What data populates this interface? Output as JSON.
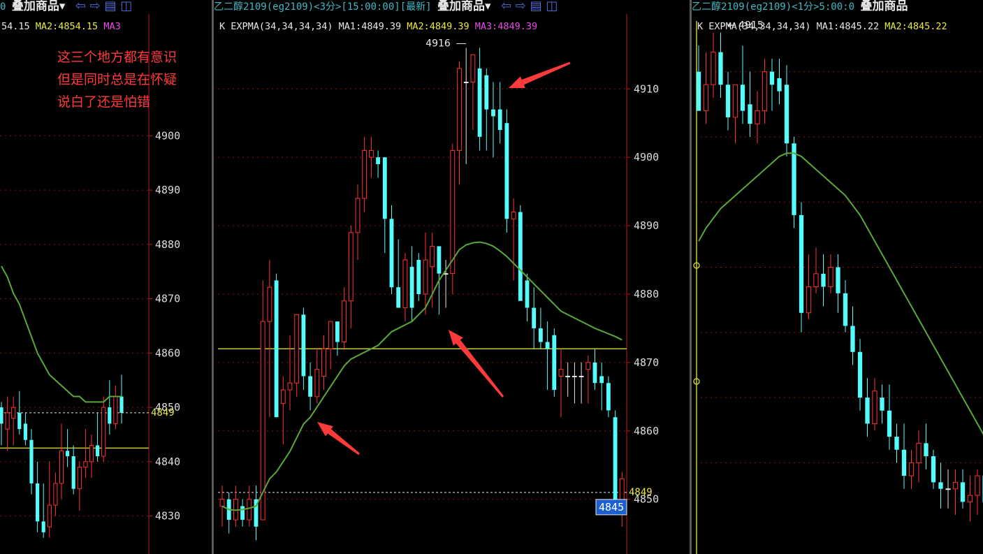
{
  "annotation": {
    "line1": "这三个地方都有意识",
    "line2": "但是同时总是在怀疑",
    "line3": "说白了还是怕错"
  },
  "colors": {
    "up": "#ff3232",
    "down": "#54fcfc",
    "ma": "#5aa83a",
    "hline": "#c8c83a",
    "grid": "#8a1010",
    "axis": "#c01818",
    "annotation": "#ff3a3a",
    "price_box": "#1c5fd0"
  },
  "panes": [
    {
      "header": {
        "pre": "0",
        "bold": "叠加商品▾",
        "icons": "⇦ ⇨ ▤ ◫"
      },
      "indicator": {
        "text1": "54.15",
        "ma2": "MA2:4854.15",
        "ma3": "MA3"
      },
      "chart_data": {
        "type": "candlestick",
        "ylim": [
          4823,
          4925
        ],
        "y_ticks": [
          4830,
          4840,
          4850,
          4860,
          4870,
          4880,
          4890,
          4900
        ],
        "hline": 4842.5,
        "last_price": 4849,
        "last_label": "4849",
        "candles": [
          {
            "o": 4850,
            "h": 4851,
            "l": 4843,
            "c": 4847
          },
          {
            "o": 4846,
            "h": 4852,
            "l": 4842,
            "c": 4849
          },
          {
            "o": 4848,
            "h": 4852,
            "l": 4843,
            "c": 4850
          },
          {
            "o": 4849,
            "h": 4853,
            "l": 4845,
            "c": 4846
          },
          {
            "o": 4847,
            "h": 4849,
            "l": 4843,
            "c": 4844
          },
          {
            "o": 4844,
            "h": 4846,
            "l": 4834,
            "c": 4836
          },
          {
            "o": 4836,
            "h": 4840,
            "l": 4827,
            "c": 4829
          },
          {
            "o": 4829,
            "h": 4836,
            "l": 4826,
            "c": 4827
          },
          {
            "o": 4828,
            "h": 4840,
            "l": 4826,
            "c": 4832
          },
          {
            "o": 4832,
            "h": 4838,
            "l": 4830,
            "c": 4836
          },
          {
            "o": 4836,
            "h": 4847,
            "l": 4833,
            "c": 4842
          },
          {
            "o": 4842,
            "h": 4846,
            "l": 4839,
            "c": 4841
          },
          {
            "o": 4841,
            "h": 4843,
            "l": 4834,
            "c": 4835
          },
          {
            "o": 4835,
            "h": 4840,
            "l": 4831,
            "c": 4839
          },
          {
            "o": 4839,
            "h": 4846,
            "l": 4837,
            "c": 4840
          },
          {
            "o": 4840,
            "h": 4845,
            "l": 4837,
            "c": 4843
          },
          {
            "o": 4843,
            "h": 4849,
            "l": 4840,
            "c": 4841
          },
          {
            "o": 4841,
            "h": 4852,
            "l": 4840,
            "c": 4850
          },
          {
            "o": 4850,
            "h": 4855,
            "l": 4845,
            "c": 4847
          },
          {
            "o": 4847,
            "h": 4854,
            "l": 4846,
            "c": 4852
          },
          {
            "o": 4852,
            "h": 4856,
            "l": 4847,
            "c": 4849
          }
        ],
        "ma": [
          4876,
          4874,
          4871,
          4869,
          4866,
          4863,
          4860,
          4858,
          4856,
          4855,
          4854,
          4853,
          4852,
          4852,
          4851,
          4851,
          4851,
          4851,
          4852,
          4852,
          4852
        ]
      }
    },
    {
      "header": {
        "pre": "乙二醇2109(eg2109)<3分>[15:00:00][最新]",
        "bold": "叠加商品▾",
        "icons": "⇦ ⇨ ▤ ◫"
      },
      "indicator": {
        "text1": "K EXPMA(34,34,34,34) MA1:4849.39",
        "ma2": "MA2:4849.39",
        "ma3": "MA3:4849.39"
      },
      "chart_data": {
        "type": "candlestick",
        "ylim": [
          4842,
          4923
        ],
        "y_ticks": [
          4850,
          4860,
          4870,
          4880,
          4890,
          4900,
          4910
        ],
        "hline": 4872,
        "last_price": 4851,
        "last_label": "4849",
        "price_box": "4845",
        "max_label": "4916",
        "candles": [
          {
            "o": 4849,
            "h": 4852,
            "l": 4846,
            "c": 4850
          },
          {
            "o": 4850,
            "h": 4851,
            "l": 4845,
            "c": 4847
          },
          {
            "o": 4847,
            "h": 4852,
            "l": 4846,
            "c": 4850
          },
          {
            "o": 4849,
            "h": 4850,
            "l": 4846,
            "c": 4847
          },
          {
            "o": 4847,
            "h": 4852,
            "l": 4846,
            "c": 4850
          },
          {
            "o": 4850,
            "h": 4852,
            "l": 4844,
            "c": 4846
          },
          {
            "o": 4847,
            "h": 4882,
            "l": 4847,
            "c": 4876
          },
          {
            "o": 4876,
            "h": 4885,
            "l": 4862,
            "c": 4881
          },
          {
            "o": 4882,
            "h": 4883,
            "l": 4862,
            "c": 4862
          },
          {
            "o": 4864,
            "h": 4868,
            "l": 4858,
            "c": 4866
          },
          {
            "o": 4866,
            "h": 4874,
            "l": 4863,
            "c": 4867
          },
          {
            "o": 4867,
            "h": 4877,
            "l": 4865,
            "c": 4877
          },
          {
            "o": 4877,
            "h": 4878,
            "l": 4866,
            "c": 4868
          },
          {
            "o": 4868,
            "h": 4870,
            "l": 4863,
            "c": 4865
          },
          {
            "o": 4865,
            "h": 4872,
            "l": 4864,
            "c": 4869
          },
          {
            "o": 4868,
            "h": 4874,
            "l": 4866,
            "c": 4872
          },
          {
            "o": 4872,
            "h": 4875,
            "l": 4869,
            "c": 4876
          },
          {
            "o": 4876,
            "h": 4876,
            "l": 4871,
            "c": 4873
          },
          {
            "o": 4873,
            "h": 4881,
            "l": 4872,
            "c": 4879
          },
          {
            "o": 4879,
            "h": 4890,
            "l": 4875,
            "c": 4889
          },
          {
            "o": 4889,
            "h": 4896,
            "l": 4885,
            "c": 4894
          },
          {
            "o": 4894,
            "h": 4903,
            "l": 4892,
            "c": 4901
          },
          {
            "o": 4900,
            "h": 4903,
            "l": 4897,
            "c": 4901
          },
          {
            "o": 4900,
            "h": 4901,
            "l": 4897,
            "c": 4899
          },
          {
            "o": 4900,
            "h": 4900,
            "l": 4886,
            "c": 4891
          },
          {
            "o": 4891,
            "h": 4893,
            "l": 4880,
            "c": 4881
          },
          {
            "o": 4881,
            "h": 4888,
            "l": 4879,
            "c": 4878
          },
          {
            "o": 4878,
            "h": 4886,
            "l": 4876,
            "c": 4885
          },
          {
            "o": 4884,
            "h": 4887,
            "l": 4876,
            "c": 4878
          },
          {
            "o": 4885,
            "h": 4886,
            "l": 4879,
            "c": 4880
          },
          {
            "o": 4880,
            "h": 4889,
            "l": 4877,
            "c": 4885
          },
          {
            "o": 4884,
            "h": 4889,
            "l": 4878,
            "c": 4887
          },
          {
            "o": 4887,
            "h": 4887,
            "l": 4877,
            "c": 4883
          },
          {
            "o": 4883,
            "h": 4885,
            "l": 4878,
            "c": 4883
          },
          {
            "o": 4883,
            "h": 4902,
            "l": 4880,
            "c": 4901
          },
          {
            "o": 4901,
            "h": 4914,
            "l": 4896,
            "c": 4913
          },
          {
            "o": 4911,
            "h": 4916,
            "l": 4899,
            "c": 4911
          },
          {
            "o": 4911,
            "h": 4913,
            "l": 4904,
            "c": 4915
          },
          {
            "o": 4913,
            "h": 4916,
            "l": 4901,
            "c": 4903
          },
          {
            "o": 4912,
            "h": 4913,
            "l": 4901,
            "c": 4907
          },
          {
            "o": 4907,
            "h": 4911,
            "l": 4900,
            "c": 4906
          },
          {
            "o": 4907,
            "h": 4911,
            "l": 4902,
            "c": 4904
          },
          {
            "o": 4905,
            "h": 4907,
            "l": 4889,
            "c": 4891
          },
          {
            "o": 4891,
            "h": 4894,
            "l": 4882,
            "c": 4892
          },
          {
            "o": 4892,
            "h": 4893,
            "l": 4880,
            "c": 4879
          },
          {
            "o": 4882,
            "h": 4883,
            "l": 4876,
            "c": 4878
          },
          {
            "o": 4878,
            "h": 4881,
            "l": 4872,
            "c": 4875
          },
          {
            "o": 4875,
            "h": 4878,
            "l": 4872,
            "c": 4873
          },
          {
            "o": 4873,
            "h": 4876,
            "l": 4866,
            "c": 4872
          },
          {
            "o": 4874,
            "h": 4875,
            "l": 4865,
            "c": 4866
          },
          {
            "o": 4868,
            "h": 4872,
            "l": 4862,
            "c": 4869
          },
          {
            "o": 4868,
            "h": 4870,
            "l": 4865,
            "c": 4868
          },
          {
            "o": 4868,
            "h": 4870,
            "l": 4864,
            "c": 4868
          },
          {
            "o": 4868,
            "h": 4870,
            "l": 4864,
            "c": 4868
          },
          {
            "o": 4869,
            "h": 4871,
            "l": 4864,
            "c": 4870
          },
          {
            "o": 4870,
            "h": 4872,
            "l": 4866,
            "c": 4867
          },
          {
            "o": 4868,
            "h": 4870,
            "l": 4863,
            "c": 4867
          },
          {
            "o": 4867,
            "h": 4868,
            "l": 4862,
            "c": 4863
          },
          {
            "o": 4862,
            "h": 4863,
            "l": 4848,
            "c": 4848
          },
          {
            "o": 4848,
            "h": 4854,
            "l": 4846,
            "c": 4853
          }
        ],
        "ma": [
          4849,
          4848.5,
          4848.4,
          4848.5,
          4848.7,
          4849,
          4851,
          4853,
          4854,
          4855.5,
          4857,
          4859,
          4861,
          4862,
          4863.5,
          4865,
          4866.5,
          4868,
          4869.5,
          4870.5,
          4871,
          4871.5,
          4872,
          4872.5,
          4873.5,
          4874.5,
          4875,
          4875.5,
          4876,
          4877,
          4878,
          4880,
          4882,
          4883.5,
          4885,
          4886.5,
          4887.2,
          4887.5,
          4887.6,
          4887.4,
          4887,
          4886.3,
          4885.5,
          4884.5,
          4883.5,
          4882.5,
          4881.5,
          4880.5,
          4879.5,
          4878.5,
          4877.5,
          4877,
          4876.5,
          4876,
          4875.5,
          4875,
          4874.6,
          4874.2,
          4873.8,
          4873.3
        ]
      }
    },
    {
      "header": {
        "pre": "乙二醇2109(eg2109)<1分>5:00:0",
        "bold": "叠加商品",
        "icons": ""
      },
      "indicator": {
        "text1": "K EXPMA(34,34,34,34) MA1:4845.22",
        "ma2": "MA2:4845.22",
        "ma3": ""
      },
      "chart_data": {
        "type": "candlestick",
        "ylim": [
          4836,
          4921
        ],
        "max_label": "4915",
        "candles": [
          {
            "o": 4910,
            "h": 4914,
            "l": 4904,
            "c": 4904
          },
          {
            "o": 4904,
            "h": 4913,
            "l": 4902,
            "c": 4908
          },
          {
            "o": 4908,
            "h": 4916,
            "l": 4906,
            "c": 4913
          },
          {
            "o": 4913,
            "h": 4916,
            "l": 4906,
            "c": 4908
          },
          {
            "o": 4908,
            "h": 4910,
            "l": 4901,
            "c": 4903
          },
          {
            "o": 4903,
            "h": 4908,
            "l": 4899,
            "c": 4908
          },
          {
            "o": 4908,
            "h": 4914,
            "l": 4902,
            "c": 4904
          },
          {
            "o": 4905,
            "h": 4910,
            "l": 4900,
            "c": 4902
          },
          {
            "o": 4902,
            "h": 4907,
            "l": 4899,
            "c": 4904
          },
          {
            "o": 4904,
            "h": 4912,
            "l": 4902,
            "c": 4910
          },
          {
            "o": 4910,
            "h": 4912,
            "l": 4904,
            "c": 4908
          },
          {
            "o": 4909,
            "h": 4912,
            "l": 4905,
            "c": 4907
          },
          {
            "o": 4908,
            "h": 4911,
            "l": 4897,
            "c": 4899
          },
          {
            "o": 4899,
            "h": 4900,
            "l": 4886,
            "c": 4888
          },
          {
            "o": 4888,
            "h": 4890,
            "l": 4870,
            "c": 4873
          },
          {
            "o": 4873,
            "h": 4882,
            "l": 4872,
            "c": 4877
          },
          {
            "o": 4877,
            "h": 4883,
            "l": 4876,
            "c": 4879
          },
          {
            "o": 4879,
            "h": 4882,
            "l": 4874,
            "c": 4877
          },
          {
            "o": 4877,
            "h": 4882,
            "l": 4876,
            "c": 4880
          },
          {
            "o": 4880,
            "h": 4882,
            "l": 4873,
            "c": 4876
          },
          {
            "o": 4876,
            "h": 4878,
            "l": 4870,
            "c": 4871
          },
          {
            "o": 4871,
            "h": 4874,
            "l": 4865,
            "c": 4867
          },
          {
            "o": 4867,
            "h": 4869,
            "l": 4858,
            "c": 4860
          },
          {
            "o": 4860,
            "h": 4863,
            "l": 4854,
            "c": 4856
          },
          {
            "o": 4856,
            "h": 4863,
            "l": 4855,
            "c": 4861
          },
          {
            "o": 4860,
            "h": 4862,
            "l": 4856,
            "c": 4858
          },
          {
            "o": 4858,
            "h": 4862,
            "l": 4852,
            "c": 4854
          },
          {
            "o": 4854,
            "h": 4856,
            "l": 4850,
            "c": 4852
          },
          {
            "o": 4852,
            "h": 4856,
            "l": 4846,
            "c": 4848
          },
          {
            "o": 4848,
            "h": 4852,
            "l": 4846,
            "c": 4850
          },
          {
            "o": 4850,
            "h": 4855,
            "l": 4847,
            "c": 4853
          },
          {
            "o": 4853,
            "h": 4856,
            "l": 4849,
            "c": 4851
          },
          {
            "o": 4851,
            "h": 4852,
            "l": 4846,
            "c": 4847
          },
          {
            "o": 4847,
            "h": 4850,
            "l": 4843,
            "c": 4846
          },
          {
            "o": 4846,
            "h": 4849,
            "l": 4843,
            "c": 4846
          },
          {
            "o": 4846,
            "h": 4849,
            "l": 4842,
            "c": 4847
          },
          {
            "o": 4847,
            "h": 4849,
            "l": 4843,
            "c": 4844
          },
          {
            "o": 4844,
            "h": 4848,
            "l": 4841,
            "c": 4845
          },
          {
            "o": 4845,
            "h": 4849,
            "l": 4842,
            "c": 4848
          },
          {
            "o": 4848,
            "h": 4850,
            "l": 4842,
            "c": 4844
          }
        ],
        "ma": [
          4884,
          4886,
          4887.5,
          4889,
          4890,
          4891,
          4892,
          4893,
          4894,
          4895,
          4896,
          4897,
          4897.5,
          4897.5,
          4897,
          4896,
          4895,
          4894,
          4893,
          4892,
          4891,
          4889.5,
          4888,
          4886,
          4884,
          4882,
          4880,
          4878,
          4876,
          4874,
          4872,
          4870,
          4868,
          4866,
          4864,
          4862,
          4860,
          4858,
          4856,
          4854
        ]
      }
    }
  ]
}
